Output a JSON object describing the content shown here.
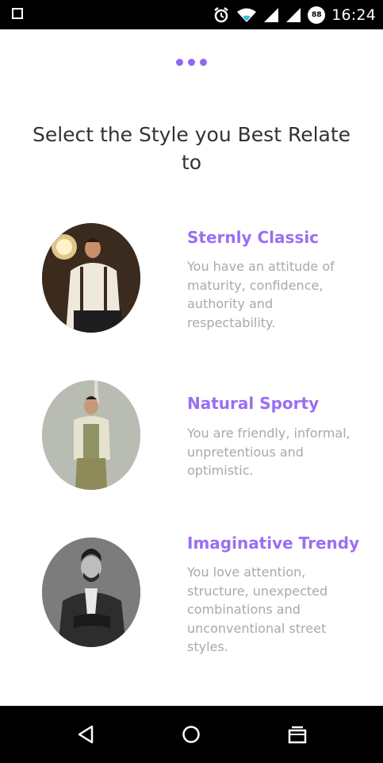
{
  "status_bar": {
    "time": "16:24",
    "battery_badge": "88",
    "icons": [
      "square-notification-icon",
      "alarm-icon",
      "wifi-icon",
      "signal-icon",
      "signal-icon",
      "battery-saver-badge"
    ]
  },
  "progress_dots": 3,
  "page": {
    "title": "Select the Style you Best Relate to"
  },
  "styles": [
    {
      "title": "Sternly Classic",
      "description": "You have an attitude of maturity, confidence, authority and respectability."
    },
    {
      "title": "Natural Sporty",
      "description": "You are friendly, informal, unpretentious and optimistic."
    },
    {
      "title": "Imaginative Trendy",
      "description": "You love attention, structure, unexpected combinations and unconventional street styles."
    }
  ],
  "nav": {
    "icons": [
      "back-icon",
      "home-icon",
      "recents-icon"
    ]
  },
  "colors": {
    "accent": "#9a6ff2",
    "description_text": "#a8a8b0",
    "title_text": "#333333"
  }
}
